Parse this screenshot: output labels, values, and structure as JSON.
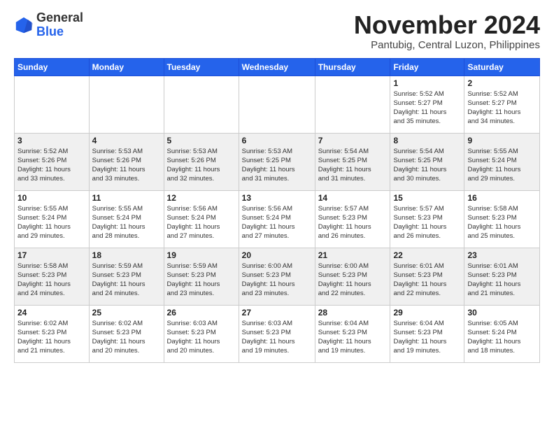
{
  "header": {
    "logo_general": "General",
    "logo_blue": "Blue",
    "month_title": "November 2024",
    "subtitle": "Pantubig, Central Luzon, Philippines"
  },
  "weekdays": [
    "Sunday",
    "Monday",
    "Tuesday",
    "Wednesday",
    "Thursday",
    "Friday",
    "Saturday"
  ],
  "weeks": [
    [
      {
        "day": "",
        "info": ""
      },
      {
        "day": "",
        "info": ""
      },
      {
        "day": "",
        "info": ""
      },
      {
        "day": "",
        "info": ""
      },
      {
        "day": "",
        "info": ""
      },
      {
        "day": "1",
        "info": "Sunrise: 5:52 AM\nSunset: 5:27 PM\nDaylight: 11 hours\nand 35 minutes."
      },
      {
        "day": "2",
        "info": "Sunrise: 5:52 AM\nSunset: 5:27 PM\nDaylight: 11 hours\nand 34 minutes."
      }
    ],
    [
      {
        "day": "3",
        "info": "Sunrise: 5:52 AM\nSunset: 5:26 PM\nDaylight: 11 hours\nand 33 minutes."
      },
      {
        "day": "4",
        "info": "Sunrise: 5:53 AM\nSunset: 5:26 PM\nDaylight: 11 hours\nand 33 minutes."
      },
      {
        "day": "5",
        "info": "Sunrise: 5:53 AM\nSunset: 5:26 PM\nDaylight: 11 hours\nand 32 minutes."
      },
      {
        "day": "6",
        "info": "Sunrise: 5:53 AM\nSunset: 5:25 PM\nDaylight: 11 hours\nand 31 minutes."
      },
      {
        "day": "7",
        "info": "Sunrise: 5:54 AM\nSunset: 5:25 PM\nDaylight: 11 hours\nand 31 minutes."
      },
      {
        "day": "8",
        "info": "Sunrise: 5:54 AM\nSunset: 5:25 PM\nDaylight: 11 hours\nand 30 minutes."
      },
      {
        "day": "9",
        "info": "Sunrise: 5:55 AM\nSunset: 5:24 PM\nDaylight: 11 hours\nand 29 minutes."
      }
    ],
    [
      {
        "day": "10",
        "info": "Sunrise: 5:55 AM\nSunset: 5:24 PM\nDaylight: 11 hours\nand 29 minutes."
      },
      {
        "day": "11",
        "info": "Sunrise: 5:55 AM\nSunset: 5:24 PM\nDaylight: 11 hours\nand 28 minutes."
      },
      {
        "day": "12",
        "info": "Sunrise: 5:56 AM\nSunset: 5:24 PM\nDaylight: 11 hours\nand 27 minutes."
      },
      {
        "day": "13",
        "info": "Sunrise: 5:56 AM\nSunset: 5:24 PM\nDaylight: 11 hours\nand 27 minutes."
      },
      {
        "day": "14",
        "info": "Sunrise: 5:57 AM\nSunset: 5:23 PM\nDaylight: 11 hours\nand 26 minutes."
      },
      {
        "day": "15",
        "info": "Sunrise: 5:57 AM\nSunset: 5:23 PM\nDaylight: 11 hours\nand 26 minutes."
      },
      {
        "day": "16",
        "info": "Sunrise: 5:58 AM\nSunset: 5:23 PM\nDaylight: 11 hours\nand 25 minutes."
      }
    ],
    [
      {
        "day": "17",
        "info": "Sunrise: 5:58 AM\nSunset: 5:23 PM\nDaylight: 11 hours\nand 24 minutes."
      },
      {
        "day": "18",
        "info": "Sunrise: 5:59 AM\nSunset: 5:23 PM\nDaylight: 11 hours\nand 24 minutes."
      },
      {
        "day": "19",
        "info": "Sunrise: 5:59 AM\nSunset: 5:23 PM\nDaylight: 11 hours\nand 23 minutes."
      },
      {
        "day": "20",
        "info": "Sunrise: 6:00 AM\nSunset: 5:23 PM\nDaylight: 11 hours\nand 23 minutes."
      },
      {
        "day": "21",
        "info": "Sunrise: 6:00 AM\nSunset: 5:23 PM\nDaylight: 11 hours\nand 22 minutes."
      },
      {
        "day": "22",
        "info": "Sunrise: 6:01 AM\nSunset: 5:23 PM\nDaylight: 11 hours\nand 22 minutes."
      },
      {
        "day": "23",
        "info": "Sunrise: 6:01 AM\nSunset: 5:23 PM\nDaylight: 11 hours\nand 21 minutes."
      }
    ],
    [
      {
        "day": "24",
        "info": "Sunrise: 6:02 AM\nSunset: 5:23 PM\nDaylight: 11 hours\nand 21 minutes."
      },
      {
        "day": "25",
        "info": "Sunrise: 6:02 AM\nSunset: 5:23 PM\nDaylight: 11 hours\nand 20 minutes."
      },
      {
        "day": "26",
        "info": "Sunrise: 6:03 AM\nSunset: 5:23 PM\nDaylight: 11 hours\nand 20 minutes."
      },
      {
        "day": "27",
        "info": "Sunrise: 6:03 AM\nSunset: 5:23 PM\nDaylight: 11 hours\nand 19 minutes."
      },
      {
        "day": "28",
        "info": "Sunrise: 6:04 AM\nSunset: 5:23 PM\nDaylight: 11 hours\nand 19 minutes."
      },
      {
        "day": "29",
        "info": "Sunrise: 6:04 AM\nSunset: 5:23 PM\nDaylight: 11 hours\nand 19 minutes."
      },
      {
        "day": "30",
        "info": "Sunrise: 6:05 AM\nSunset: 5:24 PM\nDaylight: 11 hours\nand 18 minutes."
      }
    ]
  ]
}
